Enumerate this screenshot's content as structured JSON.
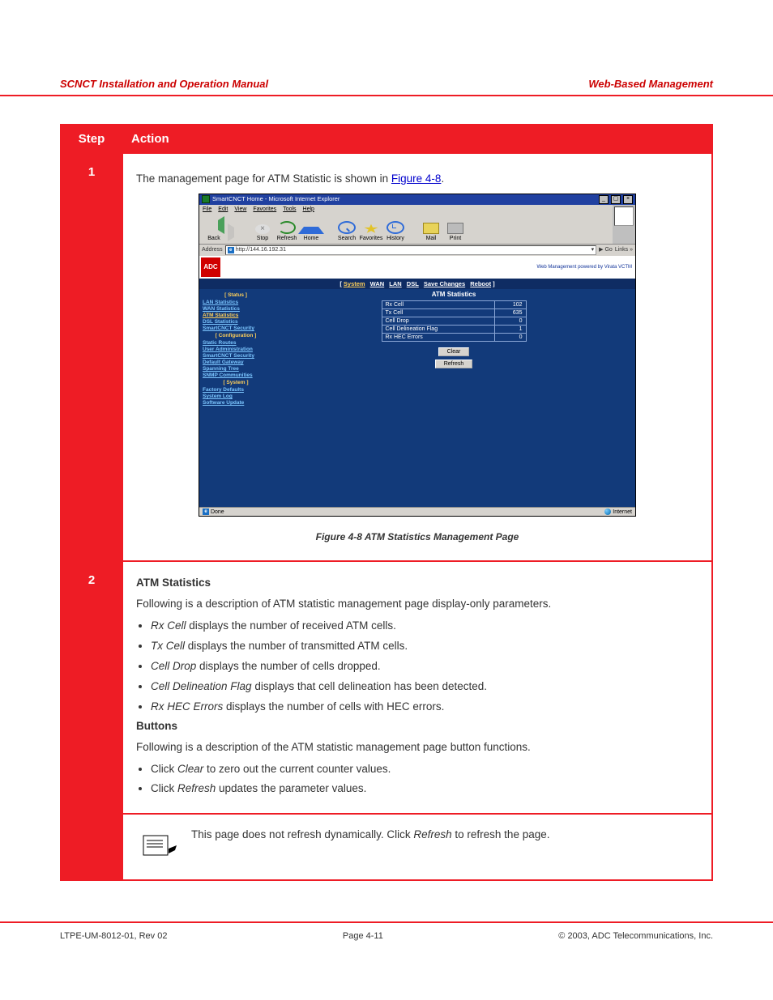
{
  "doc_header": {
    "left": "SCNCT Installation and Operation Manual",
    "right": "Web-Based Management"
  },
  "table": {
    "head_step": "Step",
    "head_action": "Action",
    "row1": {
      "step": "1",
      "caption_pre": "The management page for ATM Statistic is shown in ",
      "caption_link": "Figure 4-8",
      "caption_post": ".",
      "browser": {
        "title": "SmartCNCT Home - Microsoft Internet Explorer",
        "menu": [
          "File",
          "Edit",
          "View",
          "Favorites",
          "Tools",
          "Help"
        ],
        "tbtn": [
          "Back",
          "",
          "Stop",
          "Refresh",
          "Home",
          "Search",
          "Favorites",
          "History",
          "Mail",
          "Print"
        ],
        "addr_label": "Address",
        "addr_value": "http://144.16.192.31",
        "go": "Go",
        "links": "Links »",
        "tagline": "Web Management powered by Virata VCTM",
        "tabs": {
          "items": [
            "System",
            "WAN",
            "LAN",
            "DSL",
            "Save Changes",
            "Reboot"
          ],
          "active": 0
        },
        "status_left": "Done",
        "status_right": "Internet"
      },
      "sidenav": {
        "status_hdr": "[ Status ]",
        "status": [
          "LAN Statistics",
          "WAN Statistics",
          "ATM Statistics",
          "DSL Statistics",
          "SmartCNCT Security"
        ],
        "active_status": "ATM Statistics",
        "config_hdr": "[ Configuration ]",
        "config": [
          "Static Routes",
          "User Administration",
          "SmartCNCT Security",
          "Default Gateway",
          "Spanning Tree",
          "SNMP Communities"
        ],
        "system_hdr": "[ System ]",
        "system": [
          "Factory Defaults",
          "System Log",
          "Software Update"
        ]
      },
      "panel": {
        "title": "ATM Statistics",
        "rows": [
          {
            "k": "Rx Cell",
            "v": "102"
          },
          {
            "k": "Tx Cell",
            "v": "635"
          },
          {
            "k": "Cell Drop",
            "v": "0"
          },
          {
            "k": "Cell Delineation Flag",
            "v": "1"
          },
          {
            "k": "Rx HEC Errors",
            "v": "0"
          }
        ],
        "btn_clear": "Clear",
        "btn_refresh": "Refresh"
      },
      "figcap": "Figure 4-8   ATM Statistics Management Page"
    },
    "row2": {
      "step": "2",
      "sec_title": "ATM Statistics",
      "p1": "Following is a description of ATM statistic management page display-only parameters.",
      "items": [
        {
          "t": "Rx Cell",
          "d": " displays the number of received ATM cells."
        },
        {
          "t": "Tx Cell",
          "d": " displays the number of transmitted ATM cells."
        },
        {
          "t": "Cell Drop",
          "d": " displays the number of cells dropped."
        },
        {
          "t": "Cell Delineation Flag",
          "d": " displays that cell delineation has been detected."
        },
        {
          "t": "Rx HEC Errors",
          "d": " displays the number of cells with HEC errors."
        }
      ],
      "buttons_title": "Buttons",
      "p2": "Following is a description of the ATM statistic management page button functions.",
      "btns": [
        {
          "t": "Clear",
          "d": " to zero out the current counter values."
        },
        {
          "t": "Refresh",
          "d": " updates the parameter values."
        }
      ]
    },
    "row3": {
      "step": "",
      "note_pre": "This page does not refresh dynamically. Click ",
      "note_btn": "Refresh",
      "note_post": " to refresh the page."
    }
  },
  "footer": {
    "left": "LTPE-UM-8012-01, Rev 02",
    "center": "Page 4-11",
    "right": "© 2003, ADC Telecommunications, Inc."
  }
}
